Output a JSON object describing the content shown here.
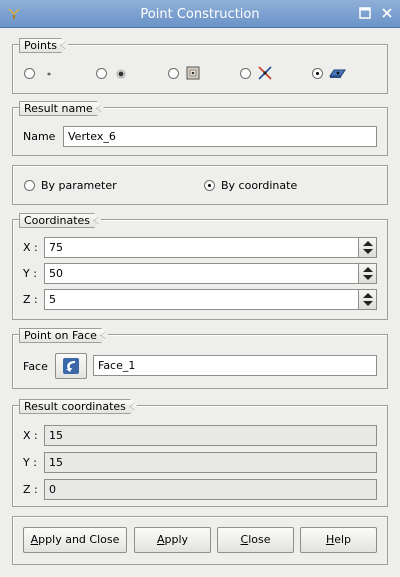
{
  "window": {
    "title": "Point Construction"
  },
  "points": {
    "legend": "Points",
    "options": [
      {
        "icon": "point-by-coords-icon",
        "checked": false
      },
      {
        "icon": "point-by-reference-icon",
        "checked": false
      },
      {
        "icon": "point-on-edge-icon",
        "checked": false
      },
      {
        "icon": "point-intersection-icon",
        "checked": false
      },
      {
        "icon": "point-on-face-icon",
        "checked": true
      }
    ]
  },
  "result_name": {
    "legend": "Result name",
    "label": "Name",
    "value": "Vertex_6"
  },
  "mode": {
    "by_parameter": "By parameter",
    "by_coordinate": "By coordinate",
    "selected": "by_coordinate"
  },
  "coordinates": {
    "legend": "Coordinates",
    "x_label": "X :",
    "x_value": "75",
    "y_label": "Y :",
    "y_value": "50",
    "z_label": "Z :",
    "z_value": "5"
  },
  "point_on_face": {
    "legend": "Point on Face",
    "label": "Face",
    "value": "Face_1"
  },
  "result_coordinates": {
    "legend": "Result coordinates",
    "x_label": "X :",
    "x_value": "15",
    "y_label": "Y :",
    "y_value": "15",
    "z_label": "Z :",
    "z_value": "0"
  },
  "buttons": {
    "apply_close": {
      "pre": "",
      "u": "A",
      "post": "pply and Close"
    },
    "apply": {
      "pre": "",
      "u": "A",
      "post": "pply"
    },
    "close": {
      "pre": "",
      "u": "C",
      "post": "lose"
    },
    "help": {
      "pre": "",
      "u": "H",
      "post": "elp"
    }
  },
  "colors": {
    "titlebar": "#6b93c8",
    "window_bg": "#eeeeec"
  }
}
